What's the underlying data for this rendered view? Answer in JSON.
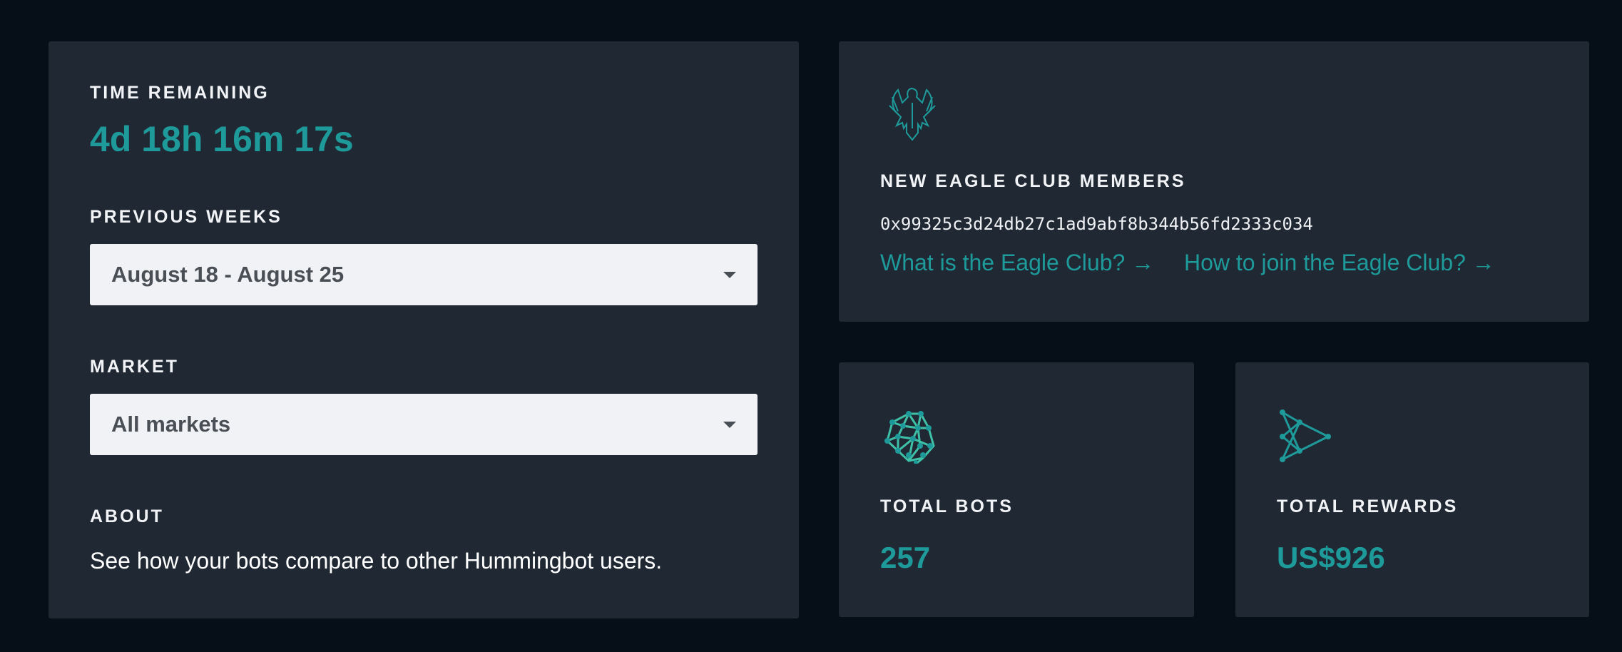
{
  "left": {
    "time_label": "TIME REMAINING",
    "time_value": "4d 18h 16m 17s",
    "weeks_label": "PREVIOUS WEEKS",
    "weeks_value": "August 18 - August 25",
    "market_label": "MARKET",
    "market_value": "All markets",
    "about_label": "ABOUT",
    "about_text": "See how your bots compare to other Hummingbot users."
  },
  "eagle": {
    "title": "NEW EAGLE CLUB MEMBERS",
    "address": "0x99325c3d24db27c1ad9abf8b344b56fd2333c034",
    "link1": "What is the Eagle Club? →",
    "link2": "How to join the Eagle Club? →"
  },
  "bots": {
    "label": "TOTAL BOTS",
    "value": "257"
  },
  "rewards": {
    "label": "TOTAL REWARDS",
    "value": "US$926"
  },
  "colors": {
    "accent": "#1e9a9a",
    "card": "#1f2833",
    "bg": "#060e17"
  }
}
